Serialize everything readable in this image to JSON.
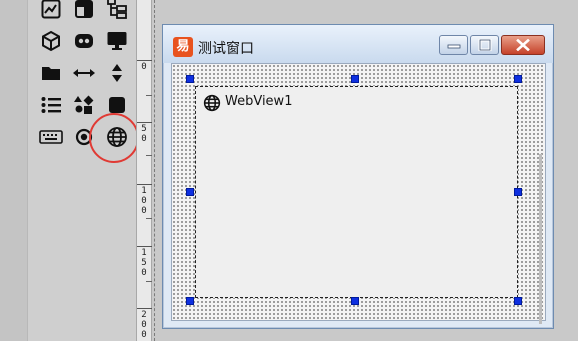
{
  "palette": {
    "tools": [
      {
        "name": "picture-icon"
      },
      {
        "name": "panel-icon"
      },
      {
        "name": "tree-icon"
      },
      {
        "name": "cube-icon"
      },
      {
        "name": "gamepad-icon"
      },
      {
        "name": "monitor-icon"
      },
      {
        "name": "folder-icon"
      },
      {
        "name": "horizontal-arrows-icon"
      },
      {
        "name": "vertical-arrows-icon"
      },
      {
        "name": "list-icon"
      },
      {
        "name": "shapes-icon"
      },
      {
        "name": "square-icon"
      },
      {
        "name": "keyboard-icon"
      },
      {
        "name": "radio-icon"
      },
      {
        "name": "globe-icon",
        "highlighted": true
      }
    ],
    "highlight_color": "#e03a34"
  },
  "ruler": {
    "labels": [
      "0",
      "5\n0",
      "1\n0\n0",
      "1\n5\n0",
      "2\n0\n0"
    ]
  },
  "window": {
    "icon_glyph": "易",
    "title": "测试窗口",
    "buttons": [
      "minimize",
      "maximize",
      "close"
    ]
  },
  "webview": {
    "label": "WebView1",
    "icon": "globe-icon",
    "handle_color": "#0e2fe0"
  }
}
